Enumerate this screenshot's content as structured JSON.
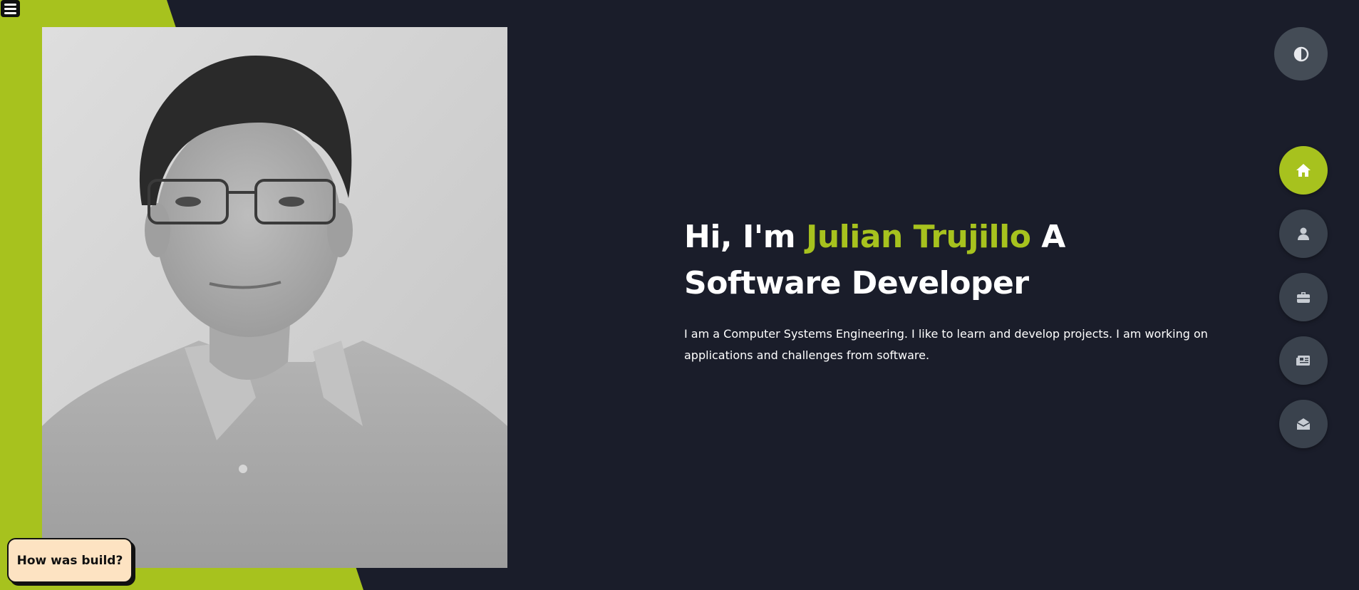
{
  "colors": {
    "background": "#1a1d2a",
    "accent": "#a7c21e",
    "nav_button": "#3a424d",
    "theme_button": "#444c56",
    "feedback_bg": "#fde3c2"
  },
  "menu": {
    "icon": "hamburger-menu-icon"
  },
  "profile_photo": {
    "alt": "Julian Trujillo"
  },
  "hero": {
    "greeting": "Hi, I'm",
    "name": "Julian Trujillo",
    "role": "A Software Developer",
    "description": "I am a Computer Systems Engineering. I like to learn and develop projects. I am working on applications and challenges from software."
  },
  "theme_toggle": {
    "icon": "contrast-icon"
  },
  "nav": {
    "items": [
      {
        "id": "home",
        "icon": "home-icon",
        "active": true
      },
      {
        "id": "about",
        "icon": "user-icon",
        "active": false
      },
      {
        "id": "portfolio",
        "icon": "briefcase-icon",
        "active": false
      },
      {
        "id": "blog",
        "icon": "newspaper-icon",
        "active": false
      },
      {
        "id": "contact",
        "icon": "envelope-open-icon",
        "active": false
      }
    ]
  },
  "feedback": {
    "label": "How was build?"
  }
}
